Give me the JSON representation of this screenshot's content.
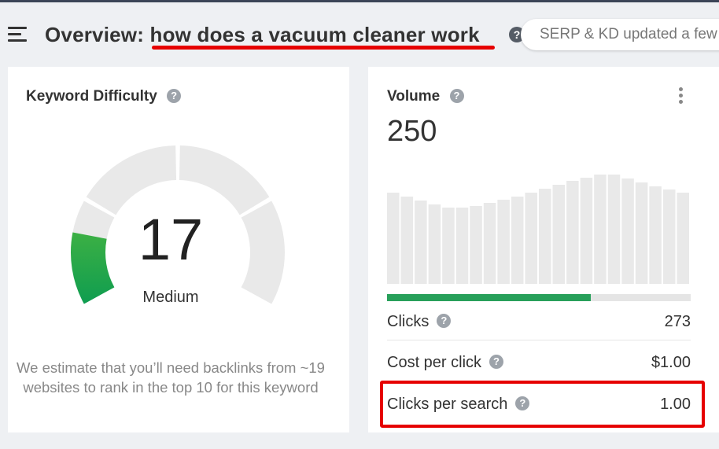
{
  "header": {
    "title": "Overview: how does a vacuum cleaner work",
    "serp_notice": "SERP & KD updated a few"
  },
  "keyword_difficulty": {
    "title": "Keyword Difficulty",
    "value": "17",
    "level": "Medium",
    "description": "We estimate that you’ll need backlinks from ~19 websites to rank in the top 10 for this keyword",
    "gauge_fraction": 0.17
  },
  "volume": {
    "title": "Volume",
    "value": "250",
    "trend_values": [
      116,
      111,
      106,
      101,
      97,
      97,
      99,
      103,
      107,
      111,
      116,
      121,
      126,
      131,
      135,
      139,
      139,
      134,
      129,
      124,
      120,
      116
    ],
    "clicks_fraction": 0.67,
    "metrics": [
      {
        "label": "Clicks",
        "value": "273"
      },
      {
        "label": "Cost per click",
        "value": "$1.00"
      },
      {
        "label": "Clicks per search",
        "value": "1.00"
      }
    ]
  },
  "colors": {
    "accent_green": "#28a05a",
    "highlight_red": "#e60000",
    "gauge_gray": "#e9e9e9",
    "bar_gray": "#e9e9e9"
  }
}
